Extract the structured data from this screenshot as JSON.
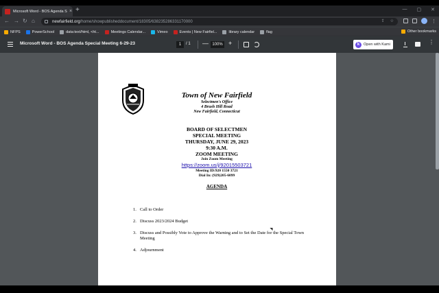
{
  "browser": {
    "tab_title": "Microsoft Word - BOS Agenda S",
    "tab_close": "×",
    "new_tab": "+",
    "url_host": "newfairfield.org",
    "url_path": "/home/showpublisheddocument/18305/638235286331170000",
    "bookmarks": [
      {
        "label": "NFPS",
        "color": "#f9ab00"
      },
      {
        "label": "PowerSchool",
        "color": "#1a73e8"
      },
      {
        "label": "data:text/html, <ht...",
        "color": "#9aa0a6"
      },
      {
        "label": "Meetings Calendar...",
        "color": "#c5221f"
      },
      {
        "label": "Vimeo",
        "color": "#1ab7ea"
      },
      {
        "label": "Events | New Fairfiel...",
        "color": "#c5221f"
      },
      {
        "label": "library calendar",
        "color": "#9aa0a6"
      },
      {
        "label": "flag",
        "color": "#9aa0a6"
      }
    ],
    "other_bookmarks": "Other bookmarks"
  },
  "pdf_toolbar": {
    "title": "Microsoft Word - BOS Agenda Special Meeting 6-29-23",
    "current_page": "1",
    "page_total": "/ 1",
    "zoom": "100%",
    "zoom_minus": "—",
    "zoom_plus": "+",
    "kami_label": "Open with Kami",
    "kami_logo": "k"
  },
  "document": {
    "town_name": "Town of New Fairfield",
    "office": "Selectmen's Office",
    "address1": "4 Brush Hill Road",
    "address2": "New Fairfield, Connecticut",
    "board": "BOARD OF SELECTMEN",
    "meeting_type": "SPECIAL MEETING",
    "date": "THURSDAY, JUNE 29, 2023",
    "time": "9:30 A.M.",
    "zoom_heading": "ZOOM MEETING",
    "join_label": "Join Zoom Meeting",
    "zoom_link": "https://zoom.us/j/92015503721",
    "meeting_id": "Meeting ID:920 1550 3721",
    "dial_in": "Dial In: (929)205-6099",
    "agenda_heading": "AGENDA",
    "agenda_items": [
      {
        "num": "1.",
        "text": "Call to Order"
      },
      {
        "num": "2.",
        "text": "Discuss 2023/2024 Budget"
      },
      {
        "num": "3.",
        "text": "Discuss and Possibly Vote to Approve the Warning and to Set the Date for the Special Town Meeting"
      },
      {
        "num": "4.",
        "text": "Adjournment"
      }
    ]
  }
}
